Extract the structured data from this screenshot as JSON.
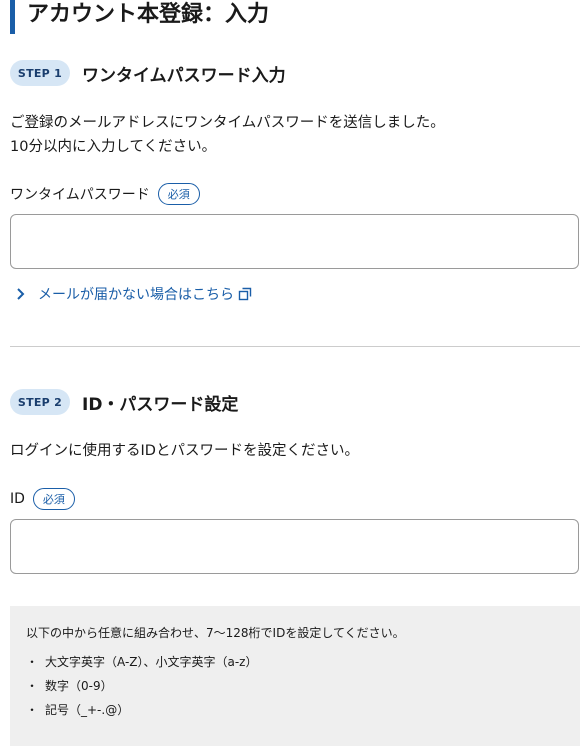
{
  "page_title": "アカウント本登録：入力",
  "step1": {
    "badge": "STEP 1",
    "title": "ワンタイムパスワード入力",
    "description_line1": "ご登録のメールアドレスにワンタイムパスワードを送信しました。",
    "description_line2": "10分以内に入力してください。",
    "field_label": "ワンタイムパスワード",
    "required_label": "必須",
    "input_value": "",
    "help_link": "メールが届かない場合はこちら"
  },
  "step2": {
    "badge": "STEP 2",
    "title": "ID・パスワード設定",
    "description": "ログインに使用するIDとパスワードを設定ください。",
    "field_label": "ID",
    "required_label": "必須",
    "input_value": "",
    "rules": {
      "intro": "以下の中から任意に組み合わせ、7〜128桁でIDを設定してください。",
      "bullet": "・",
      "items": [
        "大文字英字（A-Z）、小文字英字（a-z）",
        "数字（0-9）",
        "記号（_+-.@）"
      ]
    }
  },
  "colors": {
    "accent": "#1a5ea8",
    "badge_bg": "#d6e6f5",
    "rules_bg": "#efefef"
  },
  "icons": {
    "help_link_prefix": "chevron-right-icon",
    "help_link_suffix": "external-window-icon"
  }
}
